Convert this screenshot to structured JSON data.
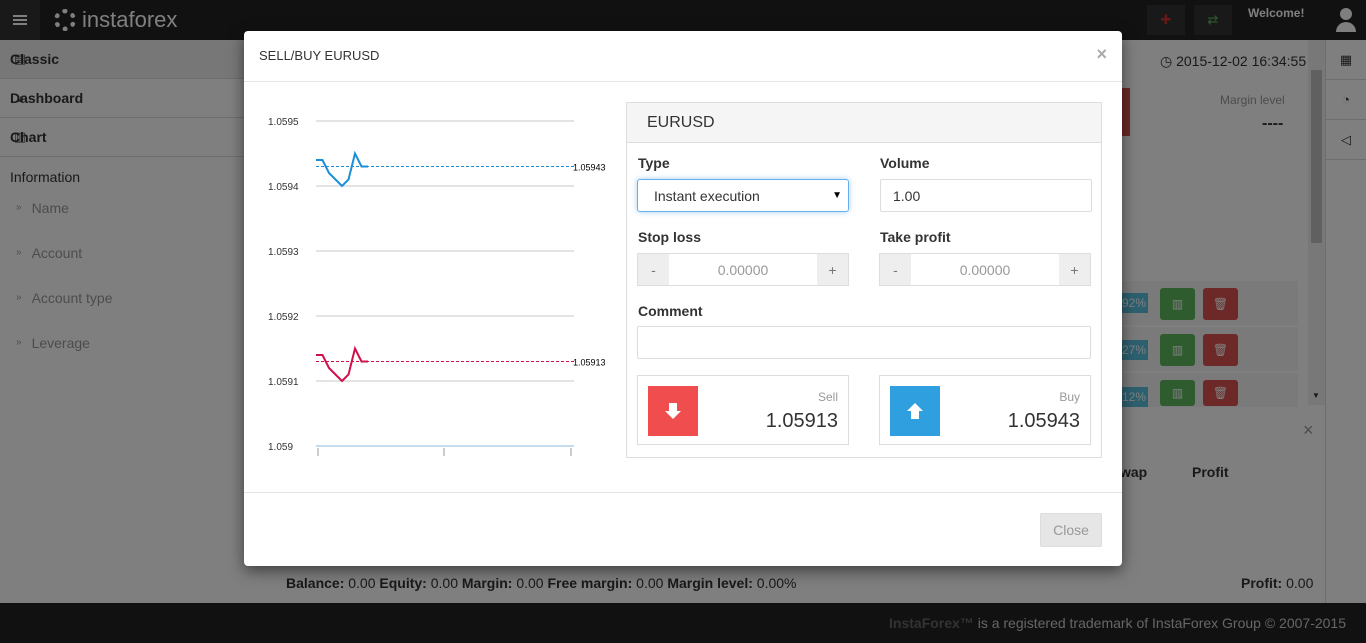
{
  "app": {
    "logo_text": "instaforex",
    "welcome": "Welcome!",
    "datetime": "2015-12-02 16:34:55"
  },
  "sidebar": {
    "items": [
      {
        "label": "Classic",
        "icon": "list-icon"
      },
      {
        "label": "Dashboard",
        "icon": "dashboard-icon"
      },
      {
        "label": "Chart",
        "icon": "bar-chart-icon"
      }
    ],
    "info_title": "Information",
    "info_rows": [
      "Name",
      "Account",
      "Account type",
      "Leverage"
    ]
  },
  "main": {
    "margin_level_label": "Margin level",
    "margin_level_value": "----",
    "pct_badges": [
      "92%",
      "27%",
      "12%"
    ],
    "columns": [
      "wap",
      "Profit"
    ]
  },
  "status": {
    "balance_label": "Balance:",
    "balance": "0.00",
    "equity_label": "Equity:",
    "equity": "0.00",
    "margin_label": "Margin:",
    "margin": "0.00",
    "free_margin_label": "Free margin:",
    "free_margin": "0.00",
    "margin_level_label": "Margin level:",
    "margin_level": "0.00%",
    "profit_label": "Profit:",
    "profit": "0.00"
  },
  "footer": {
    "brand": "InstaForex™",
    "text": " is a registered trademark of InstaForex Group © 2007-2015"
  },
  "modal": {
    "title": "SELL/BUY EURUSD",
    "close_x": "×",
    "symbol": "EURUSD",
    "type_label": "Type",
    "type_value": "Instant execution",
    "volume_label": "Volume",
    "volume_value": "1.00",
    "stop_loss_label": "Stop loss",
    "stop_loss_value": "0.00000",
    "take_profit_label": "Take profit",
    "take_profit_value": "0.00000",
    "minus": "-",
    "plus": "+",
    "comment_label": "Comment",
    "comment_value": "",
    "sell_label": "Sell",
    "sell_price": "1.05913",
    "buy_label": "Buy",
    "buy_price": "1.05943",
    "close_button": "Close",
    "colors": {
      "sell": "#f04e4e",
      "buy": "#2f9fe0",
      "ask_line": "#1a8fd8",
      "bid_line": "#d0104a"
    }
  },
  "chart_data": {
    "type": "line",
    "ytick_labels": [
      "1.0595",
      "1.0594",
      "1.0593",
      "1.0592",
      "1.0591",
      "1.059"
    ],
    "ylim": [
      1.059,
      1.0595
    ],
    "series": [
      {
        "values": [
          1.05944,
          1.05944,
          1.05942,
          1.05941,
          1.0594,
          1.05941,
          1.05945,
          1.05943,
          1.05943
        ],
        "color": "#1a8fd8"
      },
      {
        "values": [
          1.05914,
          1.05914,
          1.05912,
          1.05911,
          1.0591,
          1.05911,
          1.05915,
          1.05913,
          1.05913
        ],
        "color": "#d0104a"
      }
    ],
    "reference_lines": [
      {
        "value": 1.05943,
        "label": "1.05943",
        "color": "#1a8fd8"
      },
      {
        "value": 1.05913,
        "label": "1.05913",
        "color": "#d0104a"
      }
    ]
  }
}
